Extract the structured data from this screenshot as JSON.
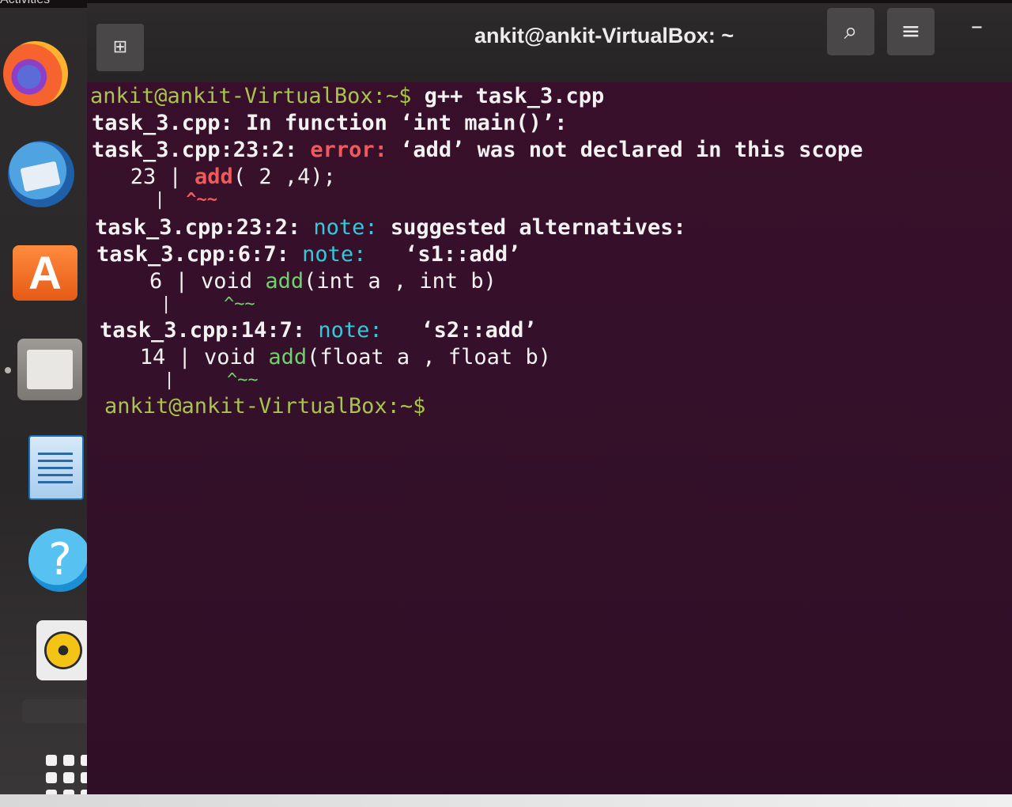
{
  "topbar": {
    "activities": "Activities"
  },
  "dock": {
    "items": [
      {
        "name": "firefox-icon"
      },
      {
        "name": "thunderbird-icon"
      },
      {
        "name": "software-store-icon",
        "glyph": "A"
      },
      {
        "name": "files-icon"
      },
      {
        "name": "libreoffice-writer-icon"
      },
      {
        "name": "help-icon",
        "glyph": "?"
      },
      {
        "name": "rhythmbox-icon"
      },
      {
        "name": "show-applications-icon"
      }
    ]
  },
  "window": {
    "title": "ankit@ankit-VirtualBox: ~",
    "new_tab_glyph": "⊞",
    "search_glyph": "⌕",
    "menu_glyph": "≡",
    "minimize_glyph": "–"
  },
  "terminal": {
    "prompt": "ankit@ankit-VirtualBox:~$",
    "command": " g++ task_3.cpp",
    "line2": "task_3.cpp: In function ‘int main()’:",
    "line3_loc": "task_3.cpp:23:2: ",
    "line3_kind": "error:",
    "line3_msg": " ‘add’ was not declared in this scope",
    "line4_num": "   23 | ",
    "line4_code_hl": "add",
    "line4_code_rest": "( 2 ,4);",
    "line5_bar": "      |",
    "line5_caret": "  ^~~",
    "line6_loc": "task_3.cpp:23:2: ",
    "line6_kind": "note:",
    "line6_msg": " suggested alternatives:",
    "line7_loc": "task_3.cpp:6:7: ",
    "line7_kind": "note:",
    "line7_msg": "   ‘s1::add’",
    "line8_num": "    6 | ",
    "line8_pre": "void ",
    "line8_hl": "add",
    "line8_rest": "(int a , int b)",
    "line9_bar": "      |",
    "line9_caret": "     ^~~",
    "line10_loc": "task_3.cpp:14:7: ",
    "line10_kind": "note:",
    "line10_msg": "   ‘s2::add’",
    "line11_num": "   14 | ",
    "line11_pre": "void ",
    "line11_hl": "add",
    "line11_rest": "(float a , float b)",
    "line12_bar": "      |",
    "line12_caret": "     ^~~",
    "final_prompt": "ankit@ankit-VirtualBox:~$"
  },
  "colors": {
    "terminal_bg": "#300a24",
    "prompt_green": "#a7c44c",
    "error_red": "#ef5a5a",
    "note_cyan": "#34c8d8",
    "highlight_green": "#6fd36a"
  }
}
